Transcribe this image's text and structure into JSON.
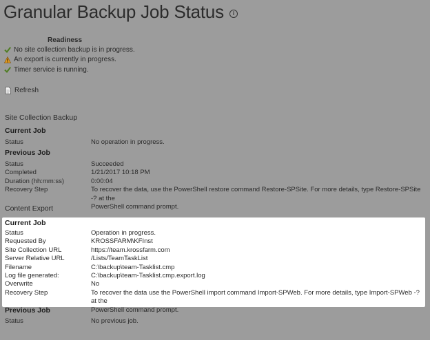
{
  "page": {
    "title": "Granular Backup Job Status",
    "info_icon": "info-circle-icon"
  },
  "readiness": {
    "heading": "Readiness",
    "items": [
      {
        "icon": "checkmark-icon",
        "text": "No site collection backup is in progress."
      },
      {
        "icon": "warning-icon",
        "text": "An export is currently in progress."
      },
      {
        "icon": "checkmark-icon",
        "text": "Timer service is running."
      }
    ]
  },
  "refresh": {
    "icon": "refresh-icon",
    "label": "Refresh"
  },
  "site_collection_backup": {
    "title": "Site Collection Backup",
    "current_job": {
      "heading": "Current Job",
      "rows": [
        {
          "key": "Status",
          "value": "No operation in progress."
        }
      ]
    },
    "previous_job": {
      "heading": "Previous Job",
      "rows": [
        {
          "key": "Status",
          "value": "Succeeded"
        },
        {
          "key": "Completed",
          "value": "1/21/2017 10:18 PM"
        },
        {
          "key": "Duration (hh:mm:ss)",
          "value": "0:00:04"
        },
        {
          "key": "Recovery Step",
          "value": "To recover the data, use the PowerShell restore command Restore-SPSite.  For more details, type Restore-SPSite -? at the",
          "value2": "PowerShell command prompt."
        }
      ]
    }
  },
  "content_export": {
    "title": "Content Export",
    "current_job": {
      "heading": "Current Job",
      "rows": [
        {
          "key": "Status",
          "value": "Operation in progress."
        },
        {
          "key": "Requested By",
          "value": "KROSSFARM\\KFInst"
        },
        {
          "key": "Site Collection URL",
          "value": "https://team.krossfarm.com"
        },
        {
          "key": "Server Relative URL",
          "value": "/Lists/TeamTaskList"
        },
        {
          "key": "Filename",
          "value": "C:\\backup\\team-Tasklist.cmp"
        },
        {
          "key": "Log file generated:",
          "value": "C:\\backup\\team-Tasklist.cmp.export.log"
        },
        {
          "key": "Overwrite",
          "value": "No"
        },
        {
          "key": "Recovery Step",
          "value": "To recover the data use the PowerShell import command Import-SPWeb. For more details, type Import-SPWeb -? at the",
          "value2": "PowerShell command prompt."
        }
      ]
    },
    "previous_job": {
      "heading": "Previous Job",
      "rows": [
        {
          "key": "Status",
          "value": "No previous job."
        }
      ]
    }
  },
  "colors": {
    "background": "#9c9c9c",
    "highlight": "#ffffff",
    "check_green": "#5a8a2a",
    "warning_orange": "#d98a1c"
  }
}
